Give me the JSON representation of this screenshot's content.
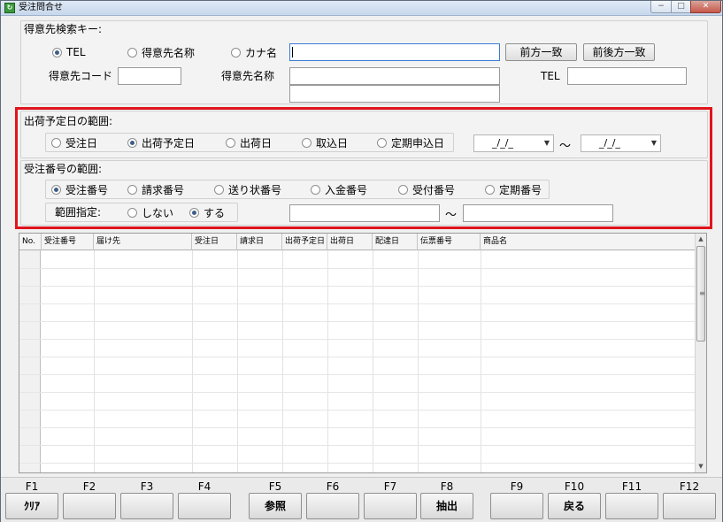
{
  "window": {
    "title": "受注問合せ",
    "min": "−",
    "max": "□",
    "close": "✕",
    "app_icon": "app-icon"
  },
  "search": {
    "section_label": "得意先検索キー:",
    "radios": [
      {
        "label": "TEL",
        "selected": true
      },
      {
        "label": "得意先名称",
        "selected": false
      },
      {
        "label": "カナ名",
        "selected": false
      }
    ],
    "key_value": "",
    "btn_prefix": "前方一致",
    "btn_both": "前後方一致",
    "customer_code_label": "得意先コード",
    "customer_code_value": "",
    "customer_name_label": "得意先名称",
    "customer_name_value1": "",
    "customer_name_value2": "",
    "tel_label": "TEL",
    "tel_value": ""
  },
  "ship_range": {
    "section_label": "出荷予定日の範囲:",
    "radios": [
      {
        "label": "受注日",
        "selected": false
      },
      {
        "label": "出荷予定日",
        "selected": true
      },
      {
        "label": "出荷日",
        "selected": false
      },
      {
        "label": "取込日",
        "selected": false
      },
      {
        "label": "定期申込日",
        "selected": false
      }
    ],
    "date_from": "_/_/_",
    "date_to": "_/_/_",
    "tilde": "～",
    "arrow": "▼"
  },
  "order_range": {
    "section_label": "受注番号の範囲:",
    "radios": [
      {
        "label": "受注番号",
        "selected": true
      },
      {
        "label": "請求番号",
        "selected": false
      },
      {
        "label": "送り状番号",
        "selected": false
      },
      {
        "label": "入金番号",
        "selected": false
      },
      {
        "label": "受付番号",
        "selected": false
      },
      {
        "label": "定期番号",
        "selected": false
      }
    ],
    "range_label": "範囲指定:",
    "range_radios": [
      {
        "label": "しない",
        "selected": false
      },
      {
        "label": "する",
        "selected": true
      }
    ],
    "from_value": "",
    "to_value": "",
    "tilde": "～"
  },
  "grid": {
    "columns": [
      "No.",
      "受注番号",
      "届け先",
      "受注日",
      "請求日",
      "出荷予定日",
      "出荷日",
      "配達日",
      "伝票番号",
      "商品名"
    ],
    "rows": [],
    "scroll_up": "▲",
    "scroll_down": "▼",
    "grip": "≡"
  },
  "fkeys": [
    {
      "key": "F1",
      "label": "ｸﾘｱ"
    },
    {
      "key": "F2",
      "label": ""
    },
    {
      "key": "F3",
      "label": ""
    },
    {
      "key": "F4",
      "label": ""
    },
    {
      "key": "F5",
      "label": "参照"
    },
    {
      "key": "F6",
      "label": ""
    },
    {
      "key": "F7",
      "label": ""
    },
    {
      "key": "F8",
      "label": "抽出"
    },
    {
      "key": "F9",
      "label": ""
    },
    {
      "key": "F10",
      "label": "戻る"
    },
    {
      "key": "F11",
      "label": ""
    },
    {
      "key": "F12",
      "label": ""
    }
  ]
}
